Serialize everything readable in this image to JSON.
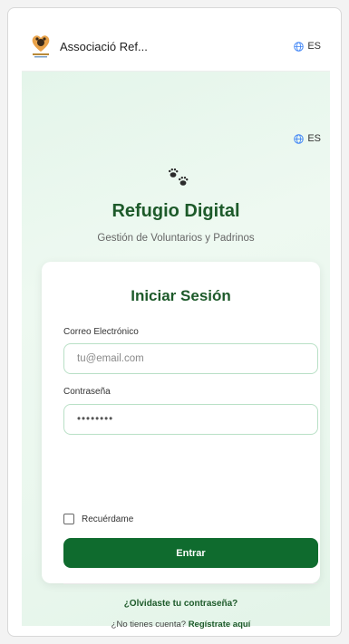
{
  "appbar": {
    "title": "Associació Ref...",
    "logo_icon": "paw-heart-logo",
    "language": "ES"
  },
  "page": {
    "language": "ES",
    "brand_title": "Refugio Digital",
    "brand_subtitle": "Gestión de Voluntarios y Padrinos"
  },
  "login": {
    "title": "Iniciar Sesión",
    "email_label": "Correo Electrónico",
    "email_placeholder": "tu@email.com",
    "email_value": "",
    "password_label": "Contraseña",
    "password_value": "••••••••",
    "remember_label": "Recuérdame",
    "submit_label": "Entrar",
    "forgot_link": "¿Olvidaste tu contraseña?",
    "no_account_text": "¿No tienes cuenta?",
    "signup_link": "Regístrate aquí"
  },
  "colors": {
    "brand_green": "#1d5a2a",
    "button_green": "#0f6b2e",
    "input_border": "#b9e0c6",
    "bg_gradient": "#e4f5ea"
  }
}
